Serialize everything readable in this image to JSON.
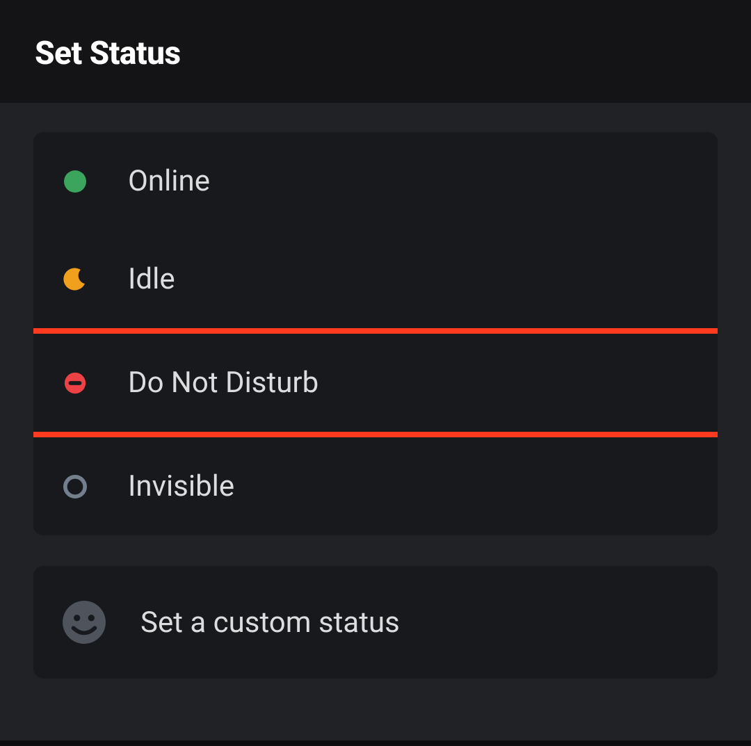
{
  "header": {
    "title": "Set Status"
  },
  "status": {
    "items": [
      {
        "label": "Online",
        "icon": "online"
      },
      {
        "label": "Idle",
        "icon": "idle"
      },
      {
        "label": "Do Not Disturb",
        "icon": "dnd",
        "highlighted": true
      },
      {
        "label": "Invisible",
        "icon": "invisible"
      }
    ]
  },
  "custom": {
    "label": "Set a custom status"
  },
  "colors": {
    "online": "#3ba55d",
    "idle": "#f0a01d",
    "dnd": "#ed4245",
    "invisible": "#747f8d",
    "highlight": "#ff3b1f"
  }
}
